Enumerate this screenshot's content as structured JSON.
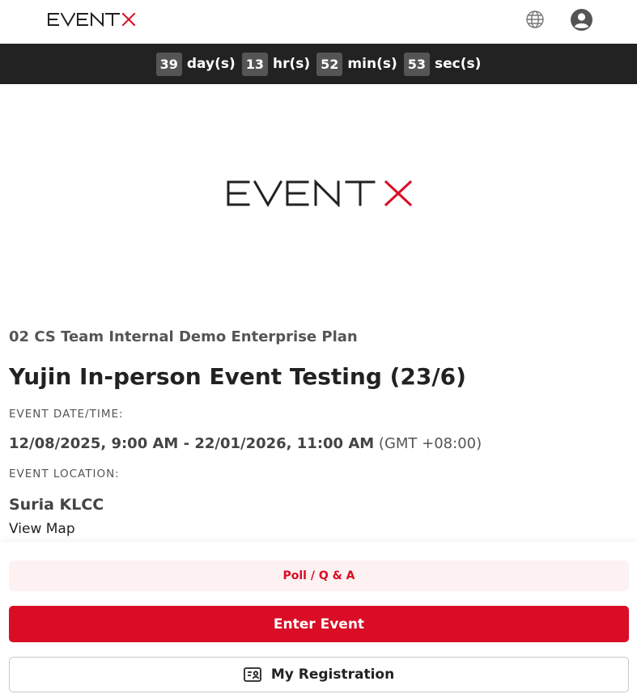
{
  "header": {
    "logo_text": "EVENTX",
    "globe_icon": "globe-icon",
    "account_icon": "account-circle-icon"
  },
  "countdown": {
    "days": "39",
    "days_unit": "day(s)",
    "hours": "13",
    "hours_unit": "hr(s)",
    "minutes": "52",
    "minutes_unit": "min(s)",
    "seconds": "53",
    "seconds_unit": "sec(s)"
  },
  "banner": {
    "logo_text": "EVENTX"
  },
  "event": {
    "organizer": "02 CS Team Internal Demo Enterprise Plan",
    "title": "Yujin In-person Event Testing (23/6)",
    "date_label": "EVENT DATE/TIME:",
    "date_range": "12/08/2025, 9:00 AM - 22/01/2026, 11:00 AM",
    "timezone": "(GMT +08:00)",
    "location_label": "EVENT LOCATION:",
    "location": "Suria KLCC",
    "view_map": "View Map"
  },
  "actions": {
    "poll_label": "Poll / Q & A",
    "enter_label": "Enter Event",
    "registration_label": "My Registration",
    "registration_icon": "id-card-icon"
  },
  "colors": {
    "brand_red": "#d90d25",
    "countdown_bg": "#222222",
    "countdown_chip": "#555555"
  }
}
